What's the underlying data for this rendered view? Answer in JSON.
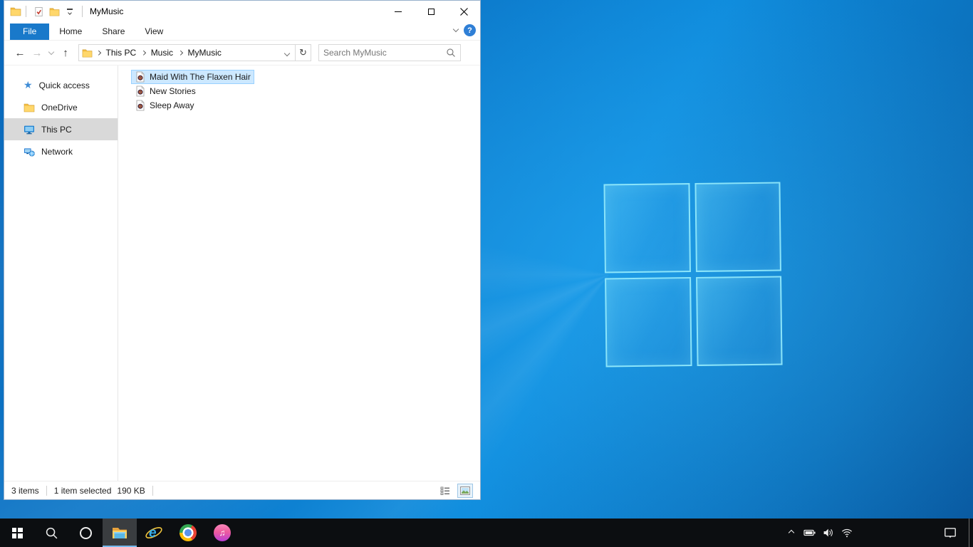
{
  "icons": {
    "back": "←",
    "forward": "→",
    "up": "↑",
    "refresh": "↻",
    "help": "?",
    "star": "★",
    "itunes_note": "♫",
    "ie_letter": "e"
  },
  "explorer": {
    "title": "MyMusic",
    "tabs": [
      {
        "label": "File"
      },
      {
        "label": "Home"
      },
      {
        "label": "Share"
      },
      {
        "label": "View"
      }
    ],
    "breadcrumb": [
      {
        "label": "This PC"
      },
      {
        "label": "Music"
      },
      {
        "label": "MyMusic"
      }
    ],
    "search": {
      "placeholder": "Search MyMusic"
    },
    "sidebar": [
      {
        "label": "Quick access"
      },
      {
        "label": "OneDrive"
      },
      {
        "label": "This PC"
      },
      {
        "label": "Network"
      }
    ],
    "files": [
      {
        "name": "Maid With The Flaxen Hair"
      },
      {
        "name": "New Stories"
      },
      {
        "name": "Sleep Away"
      }
    ],
    "status": {
      "items": "3 items",
      "selected": "1 item selected",
      "size": "190 KB"
    }
  },
  "colors": {
    "accent_tab": "#1979ca",
    "selection_bg": "#cce8ff",
    "selection_border": "#99d1ff",
    "sidebar_selected": "#d9d9d9",
    "taskbar": "#0c0e11",
    "taskbar_underline": "#76b9ed",
    "wallpaper_base": "#0d7dd1"
  }
}
